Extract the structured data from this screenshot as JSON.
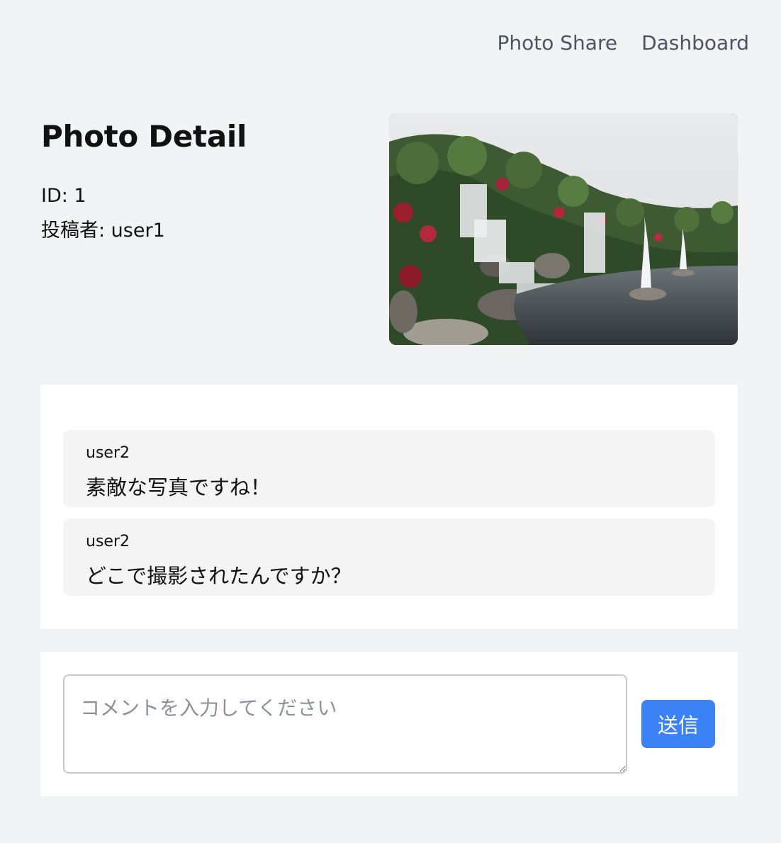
{
  "nav": {
    "links": [
      {
        "label": "Photo Share"
      },
      {
        "label": "Dashboard"
      }
    ]
  },
  "photo": {
    "heading": "Photo Detail",
    "id_line": "ID: 1",
    "author_line": "投稿者: user1"
  },
  "comments": [
    {
      "user": "user2",
      "text": "素敵な写真ですね！"
    },
    {
      "user": "user2",
      "text": "どこで撮影されたんですか？"
    }
  ],
  "comment_form": {
    "placeholder": "コメントを入力してください",
    "submit_label": "送信"
  },
  "colors": {
    "page_bg": "#f2f3f5",
    "accent": "#3b82f6",
    "nav_text": "#4b5563"
  }
}
